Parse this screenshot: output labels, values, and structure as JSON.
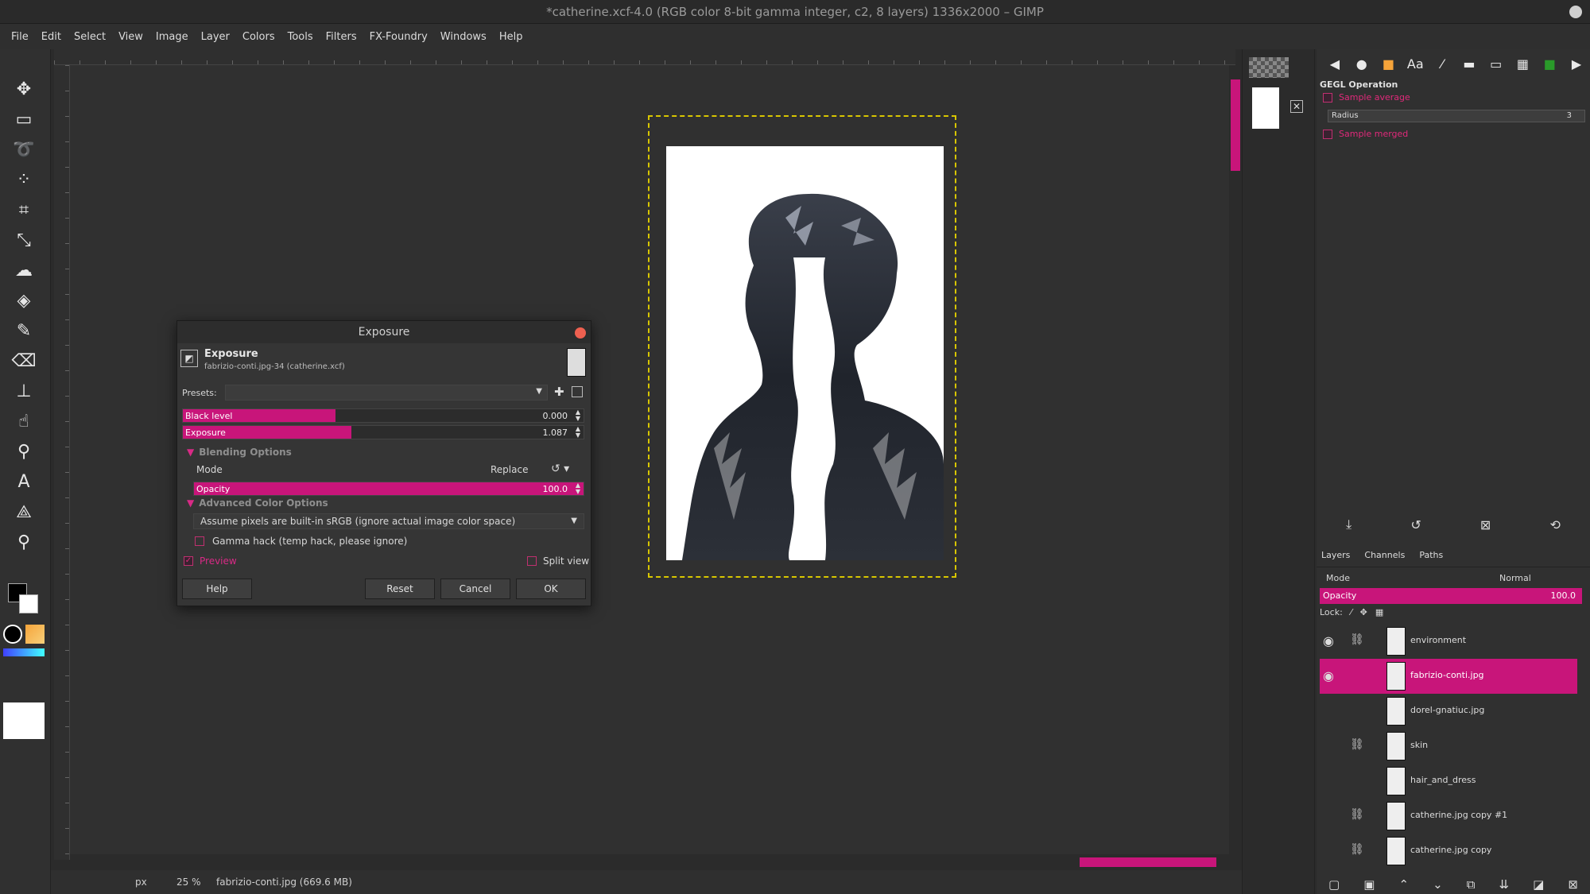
{
  "window": {
    "title": "*catherine.xcf-4.0 (RGB color 8-bit gamma integer, c2, 8 layers) 1336x2000 – GIMP"
  },
  "menu": [
    "File",
    "Edit",
    "Select",
    "View",
    "Image",
    "Layer",
    "Colors",
    "Tools",
    "Filters",
    "FX-Foundry",
    "Windows",
    "Help"
  ],
  "statusbar": {
    "unit": "px",
    "zoom": "25 %",
    "info": "fabrizio-conti.jpg (669.6 MB)"
  },
  "tool_options": {
    "title": "GEGL Operation",
    "sample_average": "Sample average",
    "radius_label": "Radius",
    "radius_value": "3",
    "sample_merged": "Sample merged"
  },
  "layers_panel": {
    "tabs": [
      "Layers",
      "Channels",
      "Paths"
    ],
    "mode_label": "Mode",
    "mode_value": "Normal",
    "opacity_label": "Opacity",
    "opacity_value": "100.0",
    "lock_label": "Lock:",
    "layers": [
      {
        "name": "environment",
        "visible": true,
        "linked": true,
        "selected": false
      },
      {
        "name": "fabrizio-conti.jpg",
        "visible": true,
        "linked": false,
        "selected": true
      },
      {
        "name": "dorel-gnatiuc.jpg",
        "visible": false,
        "linked": false,
        "selected": false
      },
      {
        "name": "skin",
        "visible": false,
        "linked": true,
        "selected": false
      },
      {
        "name": "hair_and_dress",
        "visible": false,
        "linked": false,
        "selected": false
      },
      {
        "name": "catherine.jpg copy #1",
        "visible": false,
        "linked": true,
        "selected": false
      },
      {
        "name": "catherine.jpg copy",
        "visible": false,
        "linked": true,
        "selected": false
      }
    ]
  },
  "dialog": {
    "window_title": "Exposure",
    "header_title": "Exposure",
    "header_subtitle": "fabrizio-conti.jpg-34 (catherine.xcf)",
    "presets_label": "Presets:",
    "black_level_label": "Black level",
    "black_level_value": "0.000",
    "black_level_fraction": 0.38,
    "exposure_label": "Exposure",
    "exposure_value": "1.087",
    "exposure_fraction": 0.42,
    "blending_header": "Blending Options",
    "mode_label": "Mode",
    "mode_value": "Replace",
    "opacity_label": "Opacity",
    "opacity_value": "100.0",
    "advanced_header": "Advanced Color Options",
    "color_space_option": "Assume pixels are built-in sRGB (ignore actual image color space)",
    "gamma_hack": "Gamma hack (temp hack, please ignore)",
    "preview": "Preview",
    "split_view": "Split view",
    "btn_help": "Help",
    "btn_reset": "Reset",
    "btn_cancel": "Cancel",
    "btn_ok": "OK"
  },
  "colors": {
    "accent": "#c8157a",
    "selection": "#d8c600"
  }
}
